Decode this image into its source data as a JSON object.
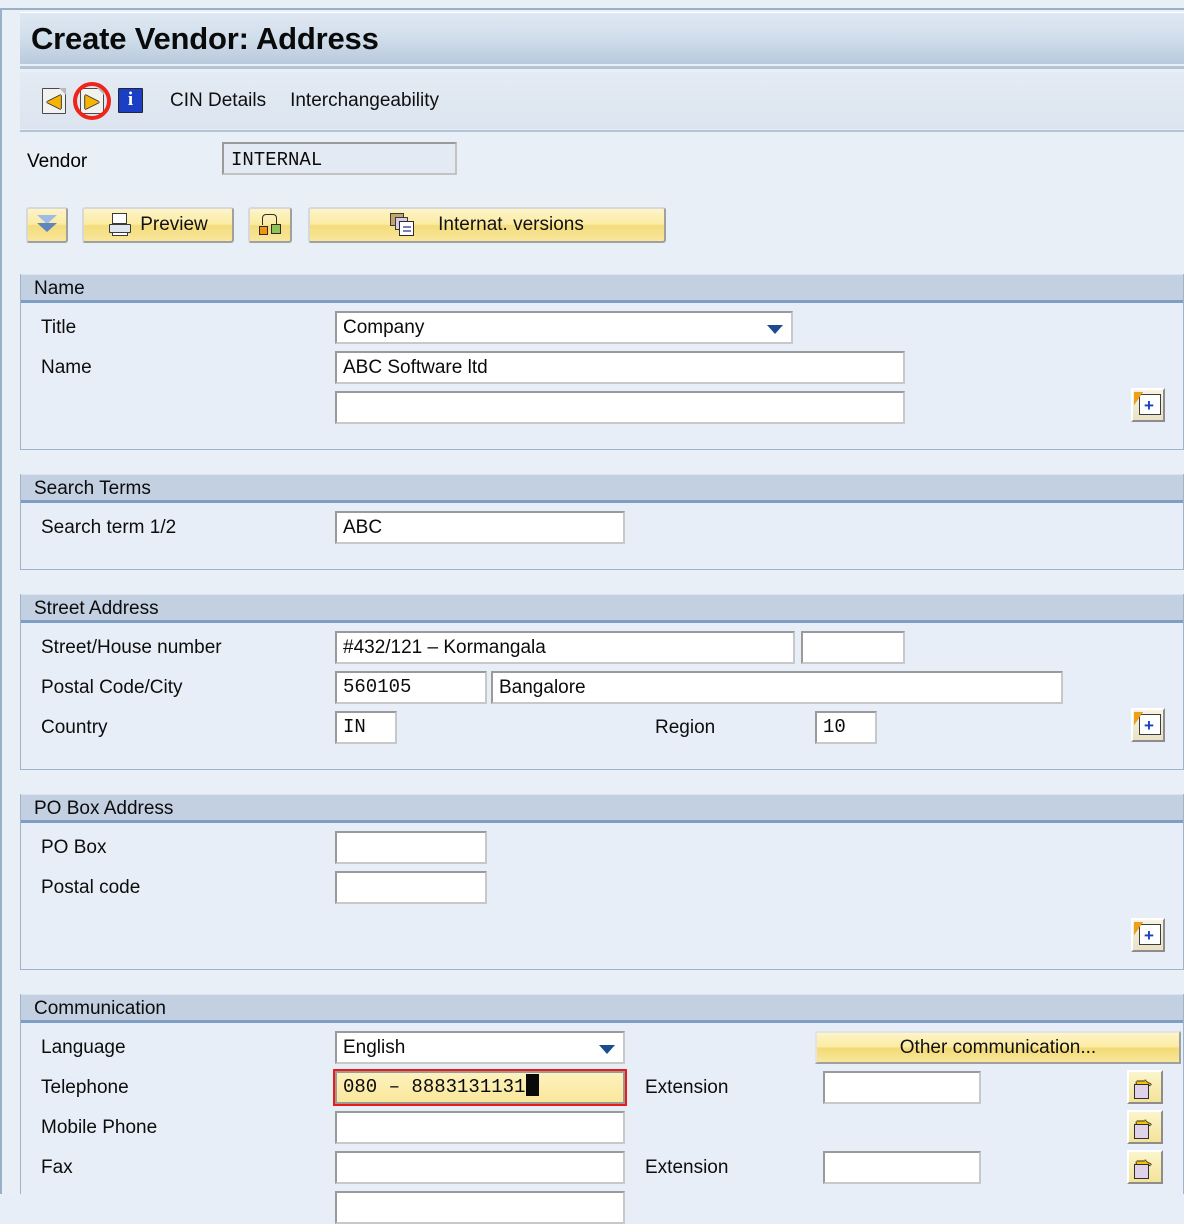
{
  "window": {
    "title": "Create Vendor: Address"
  },
  "toolbar": {
    "icons": [
      {
        "name": "back-icon",
        "glyph": "←"
      },
      {
        "name": "forward-icon",
        "glyph": "→",
        "highlighted": true
      },
      {
        "name": "info-icon",
        "glyph": "i"
      }
    ],
    "menu_items": [
      "CIN Details",
      "Interchangeability"
    ]
  },
  "vendor": {
    "label": "Vendor",
    "value": "INTERNAL"
  },
  "actions": {
    "collapse_all": "",
    "preview": "Preview",
    "relationships": "",
    "internat_versions": "Internat. versions"
  },
  "sections": {
    "name": {
      "title": "Name",
      "title_label": "Title",
      "title_value": "Company",
      "name_label": "Name",
      "name_value": "ABC Software ltd",
      "name2_value": ""
    },
    "search_terms": {
      "title": "Search Terms",
      "search_label": "Search term 1/2",
      "search_value": "ABC"
    },
    "street_address": {
      "title": "Street Address",
      "street_label": "Street/House number",
      "street_value": "#432/121 – Kormangala",
      "house_value": "",
      "postal_city_label": "Postal Code/City",
      "postal_value": "560105",
      "city_value": "Bangalore",
      "country_label": "Country",
      "country_value": "IN",
      "region_label": "Region",
      "region_value": "10"
    },
    "po_box": {
      "title": "PO Box Address",
      "pobox_label": "PO Box",
      "pobox_value": "",
      "postal_label": "Postal code",
      "postal_value": ""
    },
    "communication": {
      "title": "Communication",
      "language_label": "Language",
      "language_value": "English",
      "other_comm_button": "Other communication...",
      "telephone_label": "Telephone",
      "telephone_value": "080 – 8883131131",
      "extension_label": "Extension",
      "extension_value": "",
      "mobile_label": "Mobile Phone",
      "mobile_value": "",
      "fax_label": "Fax",
      "fax_extension_label": "Extension",
      "fax_value": "",
      "fax_extension_value": ""
    }
  },
  "colors": {
    "accent": "#c2d0e2",
    "background": "#e8eef7",
    "button_yellow": "#fbeba2",
    "focus_ring": "#ea1c16",
    "highlight_ring": "#f02418",
    "focus_field": "#f9e79b"
  }
}
